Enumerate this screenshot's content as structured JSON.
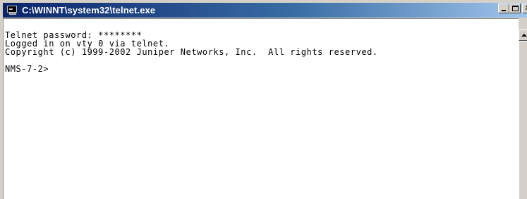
{
  "window": {
    "title": "C:\\WINNT\\system32\\telnet.exe",
    "icon": "console-window-icon",
    "buttons": {
      "minimize": "minimize-icon",
      "maximize": "maximize-icon",
      "close": "close-icon"
    }
  },
  "console": {
    "lines": [
      "Telnet password: ********",
      "Logged in on vty 0 via telnet.",
      "Copyright (c) 1999-2002 Juniper Networks, Inc.  All rights reserved.",
      "",
      "NMS-7-2>"
    ]
  }
}
